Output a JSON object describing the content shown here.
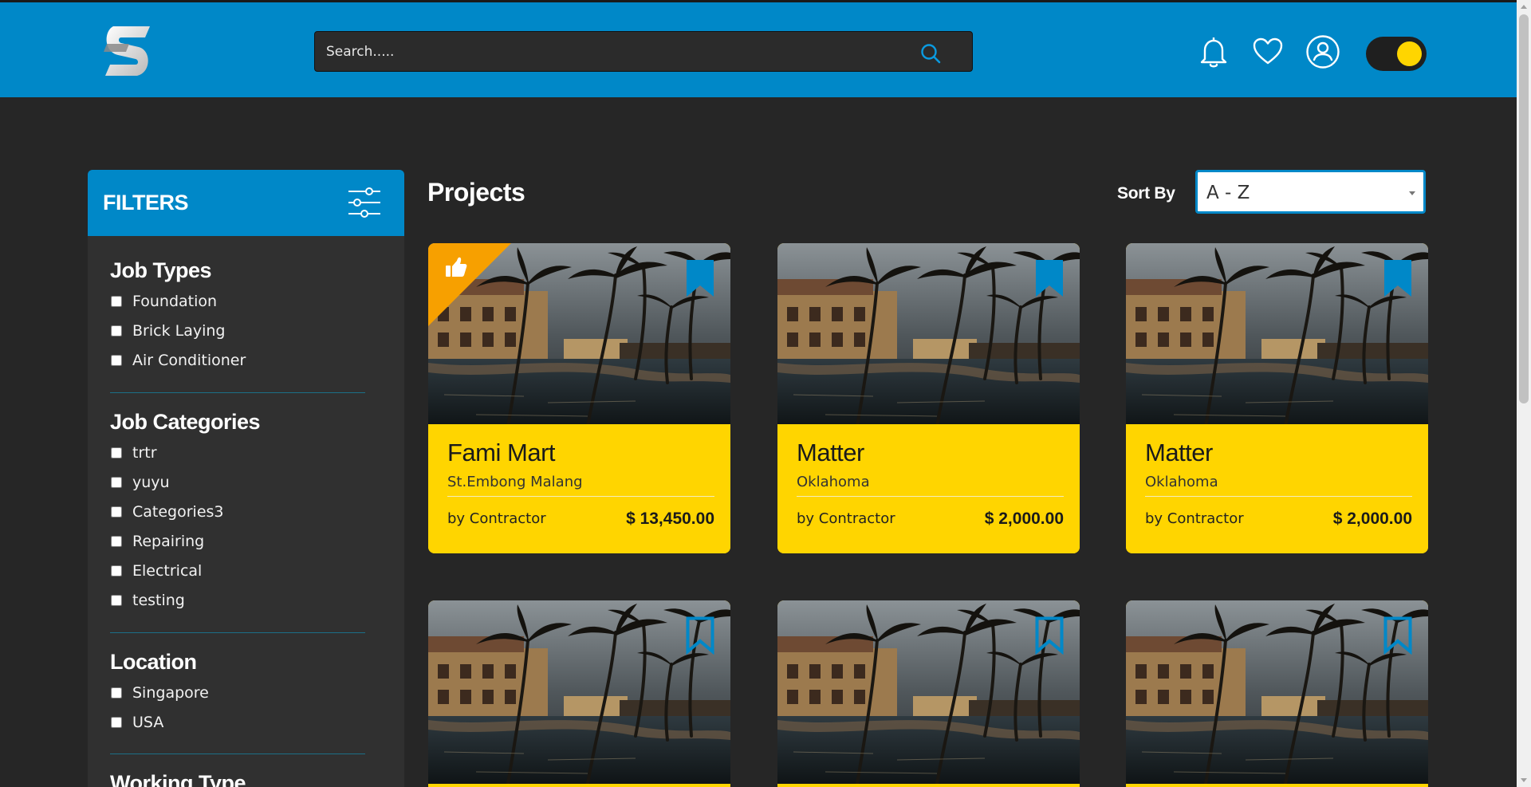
{
  "header": {
    "logo_letter": "S",
    "search_placeholder": "Search.....",
    "theme_toggle_on": true
  },
  "filters": {
    "title": "FILTERS",
    "groups": [
      {
        "title": "Job Types",
        "options": [
          "Foundation",
          "Brick Laying",
          "Air Conditioner"
        ]
      },
      {
        "title": "Job Categories",
        "options": [
          "trtr",
          "yuyu",
          "Categories3",
          "Repairing",
          "Electrical",
          "testing"
        ]
      },
      {
        "title": "Location",
        "options": [
          "Singapore",
          "USA"
        ]
      },
      {
        "title": "Working Type",
        "options": []
      }
    ]
  },
  "main": {
    "title": "Projects",
    "sort_label": "Sort By",
    "sort_value": "A - Z"
  },
  "cards": [
    {
      "title": "Fami Mart",
      "location": "St.Embong Malang",
      "by": "by Contractor",
      "price": "$ 13,450.00",
      "featured": true,
      "bookmarked": true
    },
    {
      "title": "Matter",
      "location": "Oklahoma",
      "by": "by Contractor",
      "price": "$ 2,000.00",
      "featured": false,
      "bookmarked": true
    },
    {
      "title": "Matter",
      "location": "Oklahoma",
      "by": "by Contractor",
      "price": "$ 2,000.00",
      "featured": false,
      "bookmarked": true
    },
    {
      "bookmarked": false
    },
    {
      "bookmarked": false
    },
    {
      "bookmarked": false
    }
  ],
  "colors": {
    "brand_blue": "#0088c8",
    "accent_yellow": "#ffd500",
    "featured_orange": "#f7a000",
    "background": "#262626",
    "panel": "#303030"
  },
  "icons": [
    "search-icon",
    "bell-icon",
    "heart-icon",
    "user-icon",
    "filter-sliders-icon",
    "bookmark-icon",
    "thumbs-up-icon"
  ]
}
